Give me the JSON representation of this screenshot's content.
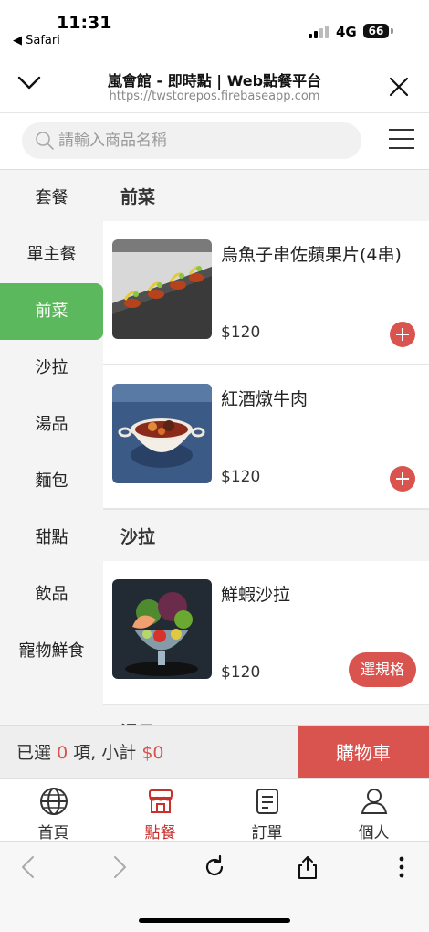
{
  "status_bar": {
    "time": "11:31",
    "back_app": "◀ Safari",
    "network": "4G",
    "battery": "66"
  },
  "header": {
    "title": "嵐會館 - 即時點 | Web點餐平台",
    "url": "https://twstorepos.firebaseapp.com"
  },
  "search": {
    "placeholder": "請輸入商品名稱"
  },
  "sidebar": {
    "items": [
      {
        "label": "套餐"
      },
      {
        "label": "單主餐"
      },
      {
        "label": "前菜"
      },
      {
        "label": "沙拉"
      },
      {
        "label": "湯品"
      },
      {
        "label": "麵包"
      },
      {
        "label": "甜點"
      },
      {
        "label": "飲品"
      },
      {
        "label": "寵物鮮食"
      }
    ],
    "active": "前菜"
  },
  "sections": [
    {
      "title": "前菜",
      "items": [
        {
          "name": "烏魚子串佐蘋果片(4串)",
          "price": "$120",
          "action": "add"
        },
        {
          "name": "紅酒燉牛肉",
          "price": "$120",
          "action": "add"
        }
      ]
    },
    {
      "title": "沙拉",
      "items": [
        {
          "name": "鮮蝦沙拉",
          "price": "$120",
          "action": "spec",
          "action_label": "選規格"
        }
      ]
    },
    {
      "title": "湯品",
      "items": []
    }
  ],
  "cart": {
    "selected_prefix": "已選",
    "count": "0",
    "items_suffix": "項, 小計",
    "subtotal": "$0",
    "button_label": "購物車"
  },
  "tabs": [
    {
      "label": "首頁",
      "icon": "globe-icon"
    },
    {
      "label": "點餐",
      "icon": "store-icon",
      "active": true
    },
    {
      "label": "訂單",
      "icon": "receipt-icon"
    },
    {
      "label": "個人",
      "icon": "person-icon"
    }
  ],
  "colors": {
    "accent_green": "#5cb85c",
    "accent_red": "#d9534f"
  }
}
